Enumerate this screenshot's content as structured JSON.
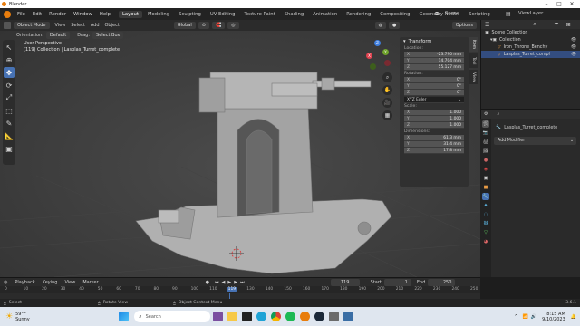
{
  "window": {
    "title": "Blender"
  },
  "menu": {
    "items": [
      "File",
      "Edit",
      "Render",
      "Window",
      "Help"
    ]
  },
  "workspaces": [
    {
      "label": "Layout",
      "active": true
    },
    {
      "label": "Modeling",
      "active": false
    },
    {
      "label": "Sculpting",
      "active": false
    },
    {
      "label": "UV Editing",
      "active": false
    },
    {
      "label": "Texture Paint",
      "active": false
    },
    {
      "label": "Shading",
      "active": false
    },
    {
      "label": "Animation",
      "active": false
    },
    {
      "label": "Rendering",
      "active": false
    },
    {
      "label": "Compositing",
      "active": false
    },
    {
      "label": "Geometry Nodes",
      "active": false
    },
    {
      "label": "Scripting",
      "active": false
    }
  ],
  "scene": {
    "name": "Scene",
    "view_layer": "ViewLayer"
  },
  "viewport_header": {
    "mode": "Object Mode",
    "view": "View",
    "select": "Select",
    "add": "Add",
    "object": "Object",
    "transform": "Global",
    "options": "Options"
  },
  "viewport_header2": {
    "orientation_label": "Orientation:",
    "orientation_value": "Default",
    "drag_label": "Drag:",
    "drag_value": "Select Box"
  },
  "viewport_info": {
    "line1": "User Perspective",
    "line2": "(119) Collection | Lasplas_Turret_complete"
  },
  "gizmo": {
    "x": "X",
    "y": "Y",
    "z": "Z"
  },
  "npanel": {
    "header": "Transform",
    "location_label": "Location:",
    "location": [
      {
        "axis": "X",
        "value": "-23.790 mm"
      },
      {
        "axis": "Y",
        "value": "14.704 mm"
      },
      {
        "axis": "Z",
        "value": "55.127 mm"
      }
    ],
    "rotation_label": "Rotation:",
    "rotation": [
      {
        "axis": "X",
        "value": "0°"
      },
      {
        "axis": "Y",
        "value": "0°"
      },
      {
        "axis": "Z",
        "value": "0°"
      }
    ],
    "rotation_mode": "XYZ Euler",
    "scale_label": "Scale:",
    "scale": [
      {
        "axis": "X",
        "value": "1.000"
      },
      {
        "axis": "Y",
        "value": "1.000"
      },
      {
        "axis": "Z",
        "value": "1.000"
      }
    ],
    "dimensions_label": "Dimensions:",
    "dimensions": [
      {
        "axis": "X",
        "value": "61.3 mm"
      },
      {
        "axis": "Y",
        "value": "31.4 mm"
      },
      {
        "axis": "Z",
        "value": "17.8 mm"
      }
    ],
    "tabs": [
      "Item",
      "Tool",
      "View"
    ]
  },
  "outliner": {
    "root": "Scene Collection",
    "items": [
      {
        "label": "Collection",
        "indent": 1,
        "selected": false
      },
      {
        "label": "Iron_Throne_Benchy",
        "indent": 2,
        "selected": false
      },
      {
        "label": "Lasplas_Turret_compl",
        "indent": 2,
        "selected": true
      }
    ]
  },
  "properties": {
    "object_name": "Lasplas_Turret_complete",
    "add_modifier": "Add Modifier"
  },
  "timeline": {
    "menu": [
      "Playback",
      "Keying",
      "View",
      "Marker"
    ],
    "current_frame": "119",
    "start_label": "Start",
    "start": "1",
    "end_label": "End",
    "end": "250",
    "ruler": [
      "0",
      "10",
      "20",
      "30",
      "40",
      "50",
      "60",
      "70",
      "80",
      "90",
      "100",
      "110",
      "119",
      "130",
      "140",
      "150",
      "160",
      "170",
      "180",
      "190",
      "200",
      "210",
      "220",
      "230",
      "240",
      "250"
    ],
    "ruler_pos": [
      0,
      10,
      20,
      30,
      40,
      50,
      60,
      70,
      80,
      90,
      100,
      110,
      119,
      130,
      140,
      150,
      160,
      170,
      180,
      190,
      200,
      210,
      220,
      230,
      240,
      250
    ],
    "current_value": 119
  },
  "statusbar": {
    "select": "Select",
    "rotate": "Rotate View",
    "context": "Object Context Menu",
    "version": "3.6.1"
  },
  "taskbar": {
    "weather_temp": "59°F",
    "weather_text": "Sunny",
    "search_placeholder": "Search",
    "time": "8:15 AM",
    "date": "9/10/2023"
  },
  "colors": {
    "accent": "#4772b3",
    "selection": "#334d80",
    "gizmo_x": "#e0424f",
    "gizmo_y": "#6fa32c",
    "gizmo_z": "#3f7fe0",
    "playhead": "#4772b3"
  }
}
